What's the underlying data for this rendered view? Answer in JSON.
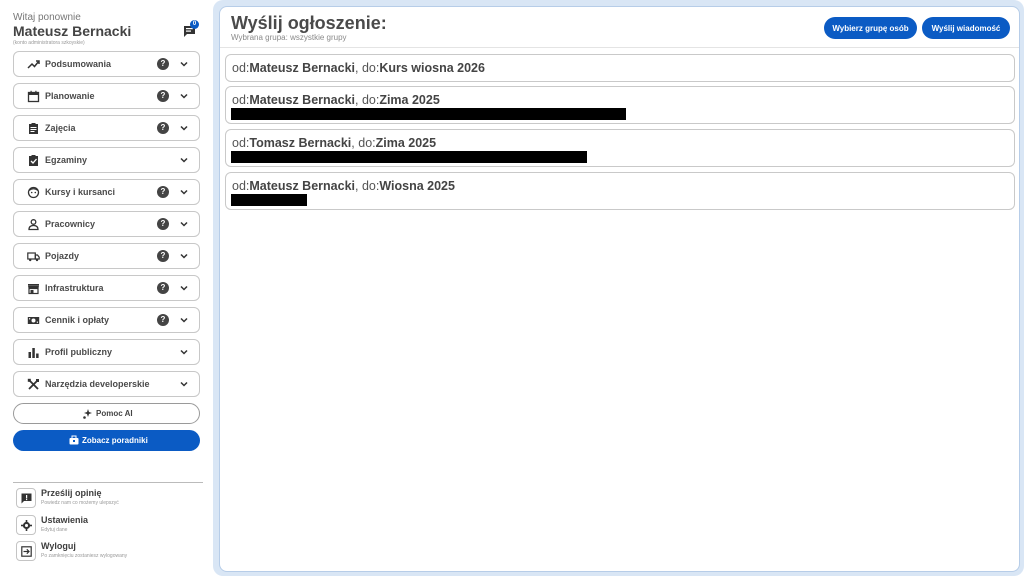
{
  "sidebar": {
    "greeting": "Witaj ponownie",
    "user_name": "Mateusz Bernacki",
    "user_role": "(konto administratora szkoyskie)",
    "messages_badge": "0",
    "menu": [
      {
        "label": "Podsumowania",
        "icon": "trending-up-icon",
        "help": true
      },
      {
        "label": "Planowanie",
        "icon": "calendar-icon",
        "help": true
      },
      {
        "label": "Zajęcia",
        "icon": "clipboard-icon",
        "help": true
      },
      {
        "label": "Egzaminy",
        "icon": "clipboard-check-icon",
        "help": false
      },
      {
        "label": "Kursy i kursanci",
        "icon": "face-icon",
        "help": true
      },
      {
        "label": "Pracownicy",
        "icon": "person-icon",
        "help": true
      },
      {
        "label": "Pojazdy",
        "icon": "truck-icon",
        "help": true
      },
      {
        "label": "Infrastruktura",
        "icon": "store-icon",
        "help": true
      },
      {
        "label": "Cennik i opłaty",
        "icon": "money-icon",
        "help": true
      },
      {
        "label": "Profil publiczny",
        "icon": "bar-chart-icon",
        "help": false
      },
      {
        "label": "Narzędzia developerskie",
        "icon": "tools-icon",
        "help": false
      }
    ],
    "ai_button": "Pomoc AI",
    "guides_button": "Zobacz poradniki",
    "footer": [
      {
        "title": "Prześlij opinię",
        "subtitle": "Powiedz nam co możemy ulepszyć",
        "icon": "feedback-icon"
      },
      {
        "title": "Ustawienia",
        "subtitle": "Edytuj dane",
        "icon": "gear-icon"
      },
      {
        "title": "Wyloguj",
        "subtitle": "Po zamknięciu zostaniesz wylogowany",
        "icon": "logout-icon"
      }
    ]
  },
  "main": {
    "title": "Wyślij ogłoszenie:",
    "subtitle": "Wybrana grupa: wszystkie grupy",
    "select_group_button": "Wybierz grupę osób",
    "send_button": "Wyślij wiadomość",
    "messages": [
      {
        "from_prefix": "od:",
        "from": "Mateusz Bernacki",
        "to_prefix": ", do:",
        "to": "Kurs wiosna 2026",
        "redacted_fraction": 0
      },
      {
        "from_prefix": "od:",
        "from": "Mateusz Bernacki",
        "to_prefix": ", do:",
        "to": "Zima 2025",
        "redacted_fraction": 0.5
      },
      {
        "from_prefix": "od:",
        "from": "Tomasz Bernacki",
        "to_prefix": ", do:",
        "to": "Zima 2025",
        "redacted_fraction": 0.45
      },
      {
        "from_prefix": "od:",
        "from": "Mateusz Bernacki",
        "to_prefix": ", do:",
        "to": "Wiosna 2025",
        "redacted_fraction": 0.1
      }
    ]
  },
  "colors": {
    "accent": "#0b5bc4",
    "panel_bg": "#d9e6f5"
  }
}
